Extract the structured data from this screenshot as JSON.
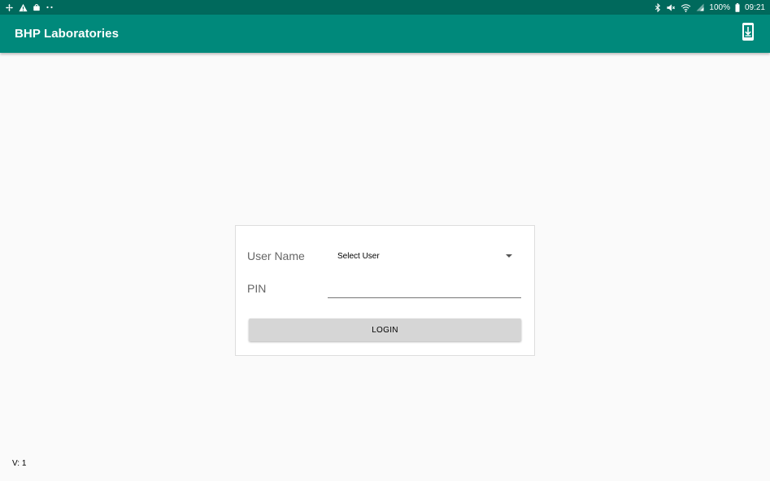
{
  "status_bar": {
    "left_icons": [
      "fan-icon",
      "warning-icon",
      "bag-icon",
      "dots-icon"
    ],
    "right_icons": [
      "bluetooth-icon",
      "mute-icon",
      "wifi-icon",
      "signal-icon",
      "battery-icon"
    ],
    "battery_text": "100%",
    "time": "09:21"
  },
  "app_bar": {
    "title": "BHP Laboratories",
    "action_icon": "download-icon",
    "background": "#00897b"
  },
  "login": {
    "username_label": "User Name",
    "user_select_value": "Select User",
    "pin_label": "PIN",
    "pin_value": "",
    "button_label": "LOGIN"
  },
  "footer": {
    "version": "V: 1"
  },
  "colors": {
    "status_bar": "#00695c",
    "app_bar": "#00897b",
    "background": "#fafafa",
    "button": "#d6d6d6"
  }
}
